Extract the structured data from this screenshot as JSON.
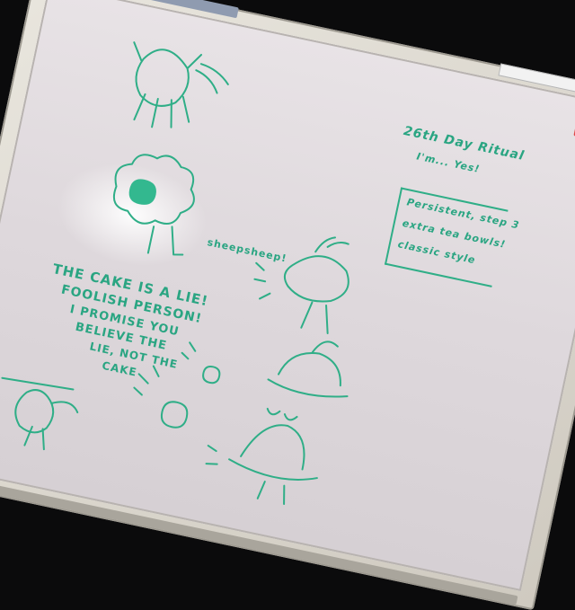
{
  "board_text": {
    "line1": "THE CAKE IS A LIE!",
    "line2": "FOOLISH PERSON!",
    "line3": "I PROMISE YOU",
    "line4": "BELIEVE THE",
    "line5": "LIE, NOT THE",
    "line6": "CAKE",
    "sheep_label": "sheepsheep!",
    "corner_heading": "26th Day Ritual",
    "corner_sub": "I'm... Yes!",
    "note_line1": "Persistent, step 3",
    "note_line2": "extra tea bowls!",
    "note_line3": "classic style"
  },
  "colors": {
    "marker": "#2fae87",
    "board": "#e3dee2",
    "frame": "#dcd8cf",
    "background": "#0b0b0c",
    "magnet": "#e04a4a"
  }
}
